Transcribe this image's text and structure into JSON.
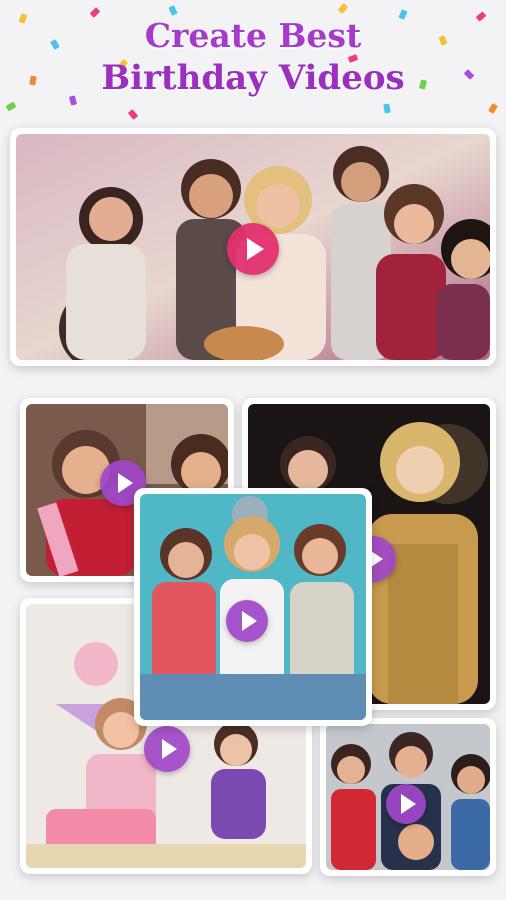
{
  "headline": {
    "line1": "Create Best",
    "line2": "Birthday Videos"
  },
  "hero": {
    "name": "Friends birthday party",
    "play_icon": "play-icon",
    "accent": "#e23070"
  },
  "collage": [
    {
      "name": "Girl with birthday sash",
      "play_icon": "play-icon"
    },
    {
      "name": "Woman in gold dress",
      "play_icon": "play-icon"
    },
    {
      "name": "Three friends with party hats",
      "play_icon": "play-icon"
    },
    {
      "name": "Birthday cake celebration",
      "play_icon": "play-icon"
    },
    {
      "name": "Group party celebration",
      "play_icon": "play-icon"
    }
  ],
  "colors": {
    "title": "#a63acb",
    "play_button": "#a046c8"
  }
}
